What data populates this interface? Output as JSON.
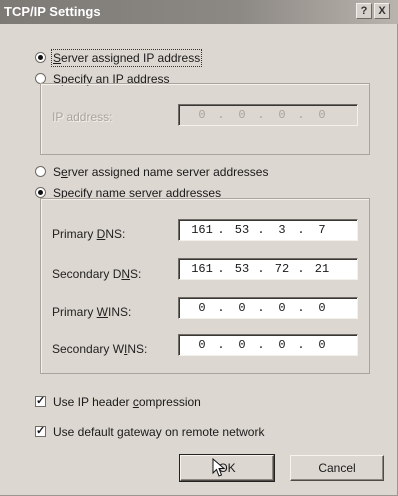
{
  "dialog": {
    "title": "TCP/IP Settings",
    "help_label": "?",
    "close_label": "X"
  },
  "ip_section": {
    "server_assigned": {
      "label_pre": "",
      "label_u": "S",
      "label_post": "erver assigned IP address",
      "selected": true
    },
    "specify": {
      "label_pre": "Specify an I",
      "label_u": "P",
      "label_post": " address",
      "selected": false
    },
    "ip_address_label": "IP address:",
    "ip_address": [
      "0",
      "0",
      "0",
      "0"
    ]
  },
  "dns_section": {
    "server_assigned": {
      "label_pre": "S",
      "label_u": "e",
      "label_post": "rver assigned name server addresses",
      "selected": false
    },
    "specify": {
      "label_pre": "Specify na",
      "label_u": "m",
      "label_post": "e server addresses",
      "selected": true
    },
    "fields": [
      {
        "label_pre": "Primary ",
        "label_u": "D",
        "label_post": "NS:",
        "octets": [
          "161",
          "53",
          "3",
          "7"
        ]
      },
      {
        "label_pre": "Secondary D",
        "label_u": "N",
        "label_post": "S:",
        "octets": [
          "161",
          "53",
          "72",
          "21"
        ]
      },
      {
        "label_pre": "Primary ",
        "label_u": "W",
        "label_post": "INS:",
        "octets": [
          "0",
          "0",
          "0",
          "0"
        ]
      },
      {
        "label_pre": "Secondary W",
        "label_u": "I",
        "label_post": "NS:",
        "octets": [
          "0",
          "0",
          "0",
          "0"
        ]
      }
    ]
  },
  "options": [
    {
      "label_pre": "Use IP header ",
      "label_u": "c",
      "label_post": "ompression",
      "checked": true
    },
    {
      "label_pre": "Use default gateway on remote network",
      "label_u": "",
      "label_post": "",
      "checked": true
    }
  ],
  "buttons": {
    "ok": "OK",
    "cancel": "Cancel"
  },
  "checkmark_glyph": "✓",
  "colors": {
    "titlebar": "#8c8883",
    "dialog_bg": "#dcd7d0"
  }
}
